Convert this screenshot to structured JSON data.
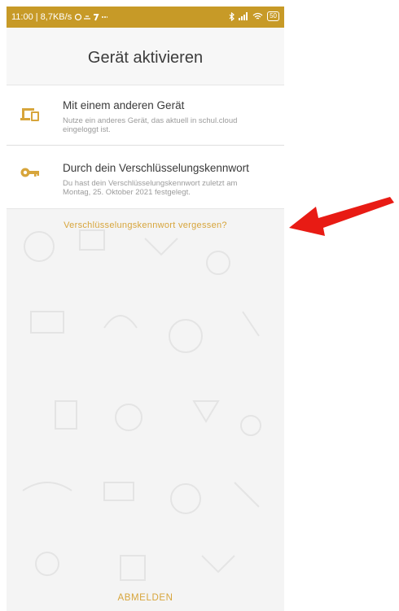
{
  "statusbar": {
    "time_speed": "11:00 | 8,7KB/s",
    "battery": "50"
  },
  "header": {
    "title": "Gerät aktivieren"
  },
  "options": [
    {
      "title": "Mit einem anderen Gerät",
      "subtitle": "Nutze ein anderes Gerät, das aktuell in schul.cloud eingeloggt ist.",
      "icon": "devices-icon"
    },
    {
      "title": "Durch dein Verschlüsselungskennwort",
      "subtitle": "Du hast dein Verschlüsselungskennwort zuletzt am Montag, 25. Oktober 2021 festgelegt.",
      "icon": "key-icon"
    }
  ],
  "links": {
    "forgot_password": "Verschlüsselungskennwort vergessen?",
    "logout": "ABMELDEN"
  },
  "colors": {
    "accent": "#D7A53B",
    "statusbar": "#C79A27",
    "annotation_arrow": "#E81B14"
  }
}
